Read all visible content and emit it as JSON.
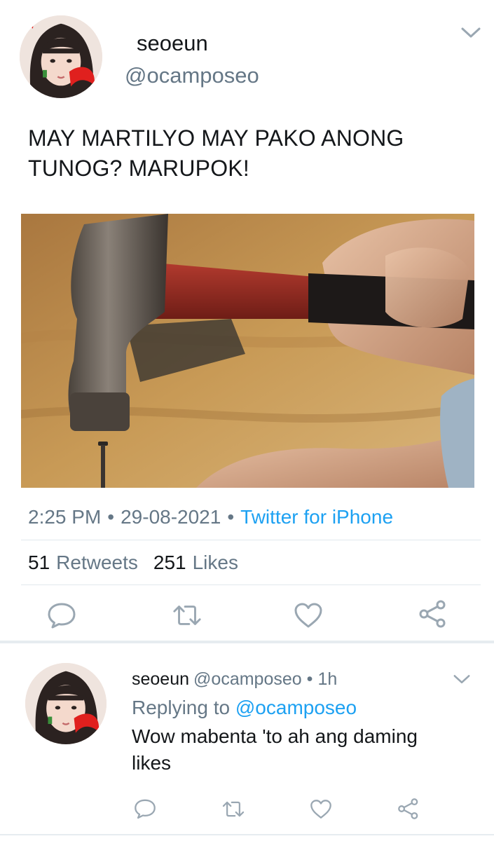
{
  "main_tweet": {
    "author_name": "seoeun",
    "author_handle": "@ocamposeo",
    "text": "MAY MARTILYO MAY PAKO ANONG TUNOG? MARUPOK!",
    "time": "2:25 PM",
    "date": "29-08-2021",
    "source": "Twitter for iPhone",
    "separator": "•",
    "retweets_count": "51",
    "retweets_label": "Retweets",
    "likes_count": "251",
    "likes_label": "Likes"
  },
  "reply_tweet": {
    "author_name": "seoeun",
    "author_handle": "@ocamposeo",
    "separator": "•",
    "time": "1h",
    "replying_prefix": "Replying to",
    "replying_handle": "@ocamposeo",
    "text": "Wow mabenta 'to ah ang daming likes"
  },
  "icons": [
    "chevron-down-icon",
    "reply-icon",
    "retweet-icon",
    "like-icon",
    "share-icon"
  ],
  "colors": {
    "text": "#14171a",
    "secondary": "#657786",
    "link": "#1da1f2",
    "divider": "#e1e8ed"
  }
}
